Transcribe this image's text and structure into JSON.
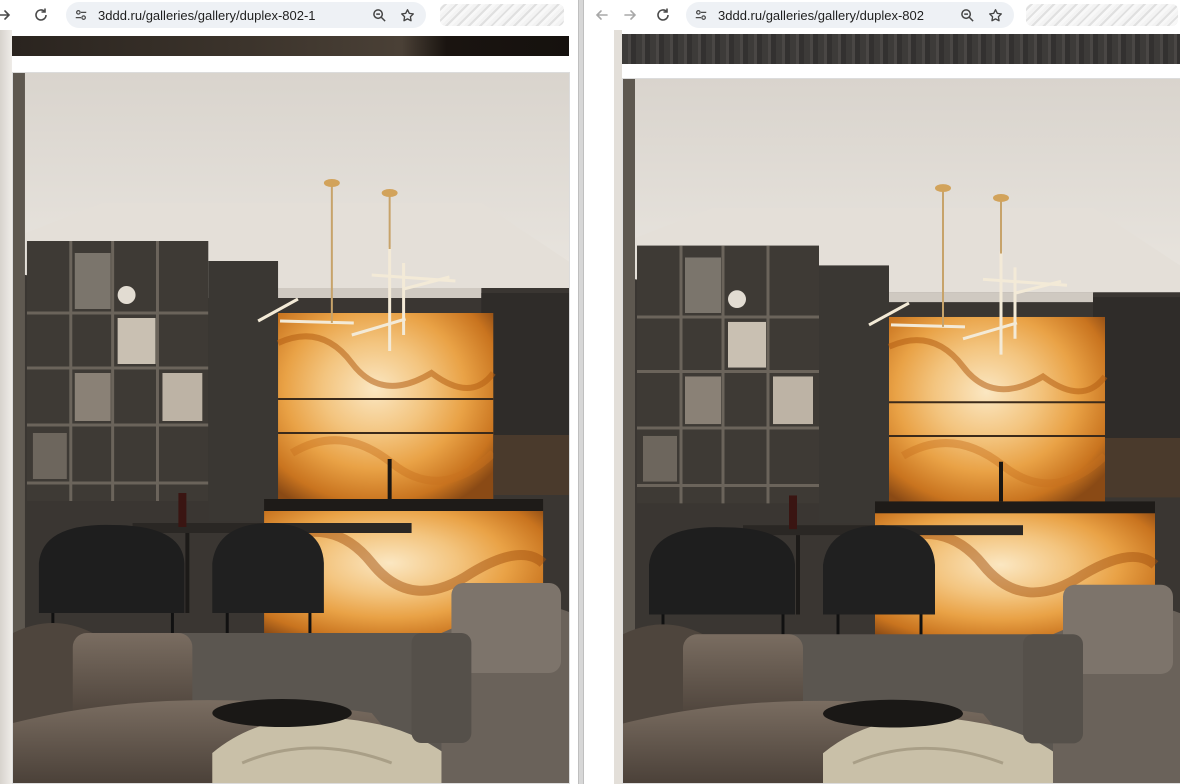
{
  "left_window": {
    "url": "3ddd.ru/galleries/gallery/duplex-802-1"
  },
  "right_window": {
    "url": "3ddd.ru/galleries/gallery/duplex-802"
  },
  "icons": {
    "back": "arrow-left-icon",
    "forward": "arrow-right-icon",
    "reload": "reload-icon",
    "site_info": "tune-icon",
    "zoom": "zoom-icon",
    "bookmark": "star-icon"
  },
  "colors": {
    "onyx": "#e9a246",
    "wood": "#3a3632",
    "ceiling": "#e9e5df"
  }
}
